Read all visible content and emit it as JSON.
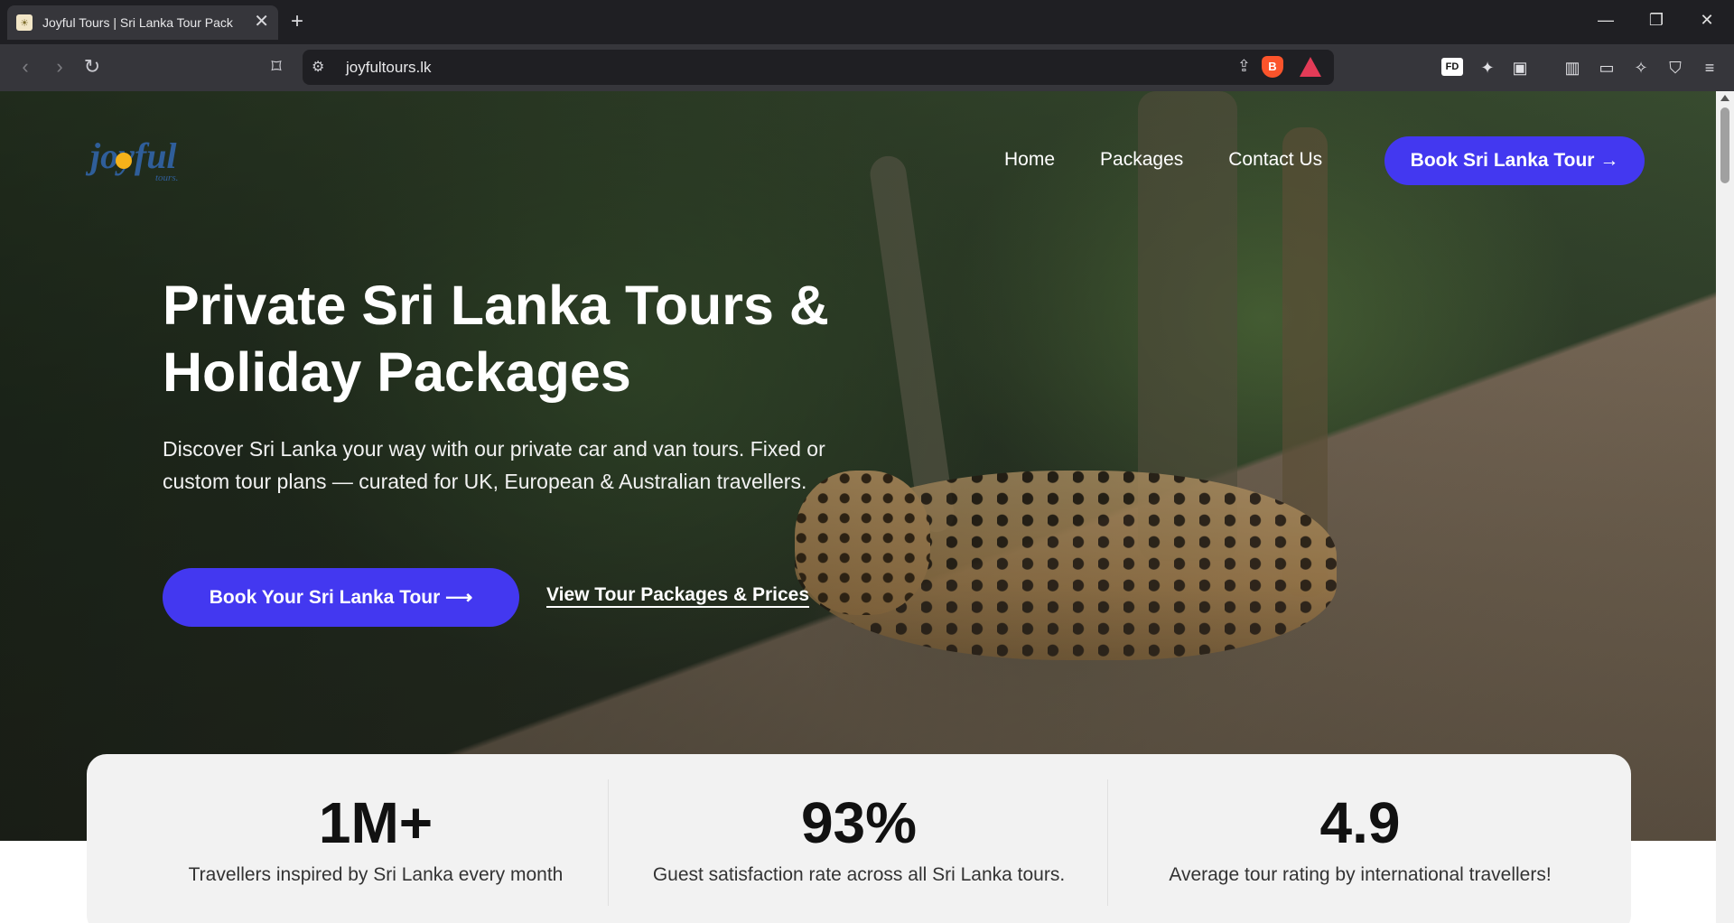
{
  "browser": {
    "tab_title": "Joyful Tours | Sri Lanka Tour Pack",
    "tab_close": "✕",
    "new_tab": "+",
    "url": "joyfultours.lk",
    "extension_fd": "FD",
    "controls": {
      "minimize": "—",
      "restore": "❐",
      "close": "✕"
    }
  },
  "site": {
    "logo_text": "joyful",
    "logo_sub": "tours.",
    "nav": [
      {
        "label": "Home"
      },
      {
        "label": "Packages"
      },
      {
        "label": "Contact Us"
      }
    ],
    "nav_cta": "Book Sri Lanka Tour →"
  },
  "hero": {
    "title_line1": "Private Sri Lanka Tours &",
    "title_line2": "Holiday Packages",
    "subtitle": "Discover Sri Lanka your way with our private car and van tours. Fixed or custom tour plans — curated for UK, European & Australian travellers.",
    "primary_cta": "Book Your Sri Lanka Tour ⟶",
    "secondary_cta": "View Tour Packages & Prices"
  },
  "stats": [
    {
      "value": "1M+",
      "label": "Travellers inspired by Sri Lanka every month"
    },
    {
      "value": "93%",
      "label": "Guest satisfaction rate across all Sri Lanka tours."
    },
    {
      "value": "4.9",
      "label": "Average tour rating by international travellers!"
    }
  ],
  "colors": {
    "accent": "#4338f0",
    "chrome_dark": "#1f1f23",
    "chrome_mid": "#36363b"
  }
}
